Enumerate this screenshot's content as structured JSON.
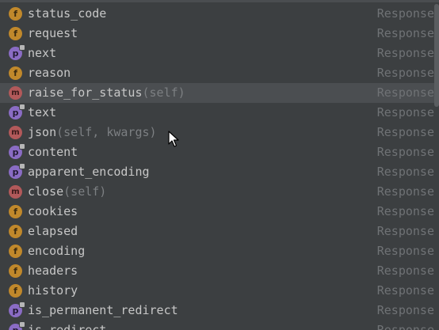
{
  "completion_popup": {
    "items": [
      {
        "kind": "field",
        "kind_letter": "f",
        "name": "status_code",
        "signature": "",
        "type": "Response",
        "selected": false,
        "icon": "field-icon"
      },
      {
        "kind": "field",
        "kind_letter": "f",
        "name": "request",
        "signature": "",
        "type": "Response",
        "selected": false,
        "icon": "field-icon"
      },
      {
        "kind": "property",
        "kind_letter": "p",
        "name": "next",
        "signature": "",
        "type": "Response",
        "selected": false,
        "icon": "property-icon"
      },
      {
        "kind": "field",
        "kind_letter": "f",
        "name": "reason",
        "signature": "",
        "type": "Response",
        "selected": false,
        "icon": "field-icon"
      },
      {
        "kind": "method",
        "kind_letter": "m",
        "name": "raise_for_status",
        "signature": "(self)",
        "type": "Response",
        "selected": true,
        "icon": "method-icon"
      },
      {
        "kind": "property",
        "kind_letter": "p",
        "name": "text",
        "signature": "",
        "type": "Response",
        "selected": false,
        "icon": "property-icon"
      },
      {
        "kind": "method",
        "kind_letter": "m",
        "name": "json",
        "signature": "(self, kwargs)",
        "type": "Response",
        "selected": false,
        "icon": "method-icon"
      },
      {
        "kind": "property",
        "kind_letter": "p",
        "name": "content",
        "signature": "",
        "type": "Response",
        "selected": false,
        "icon": "property-icon"
      },
      {
        "kind": "property",
        "kind_letter": "p",
        "name": "apparent_encoding",
        "signature": "",
        "type": "Response",
        "selected": false,
        "icon": "property-icon"
      },
      {
        "kind": "method",
        "kind_letter": "m",
        "name": "close",
        "signature": "(self)",
        "type": "Response",
        "selected": false,
        "icon": "method-icon"
      },
      {
        "kind": "field",
        "kind_letter": "f",
        "name": "cookies",
        "signature": "",
        "type": "Response",
        "selected": false,
        "icon": "field-icon"
      },
      {
        "kind": "field",
        "kind_letter": "f",
        "name": "elapsed",
        "signature": "",
        "type": "Response",
        "selected": false,
        "icon": "field-icon"
      },
      {
        "kind": "field",
        "kind_letter": "f",
        "name": "encoding",
        "signature": "",
        "type": "Response",
        "selected": false,
        "icon": "field-icon"
      },
      {
        "kind": "field",
        "kind_letter": "f",
        "name": "headers",
        "signature": "",
        "type": "Response",
        "selected": false,
        "icon": "field-icon"
      },
      {
        "kind": "field",
        "kind_letter": "f",
        "name": "history",
        "signature": "",
        "type": "Response",
        "selected": false,
        "icon": "field-icon"
      },
      {
        "kind": "property",
        "kind_letter": "p",
        "name": "is_permanent_redirect",
        "signature": "",
        "type": "Response",
        "selected": false,
        "icon": "property-icon"
      },
      {
        "kind": "property",
        "kind_letter": "p",
        "name": "is_redirect",
        "signature": "",
        "type": "Response",
        "selected": false,
        "icon": "property-icon"
      }
    ]
  },
  "colors": {
    "background": "#3c3f41",
    "selected_row": "#4b4e51",
    "text": "#c7c7c7",
    "signature_text": "#7c7f82",
    "type_text": "#6f7275",
    "field_icon": "#c0882b",
    "method_icon": "#b2595a",
    "property_icon": "#8a6cc4"
  },
  "cursor": {
    "icon": "mouse-pointer-icon"
  }
}
